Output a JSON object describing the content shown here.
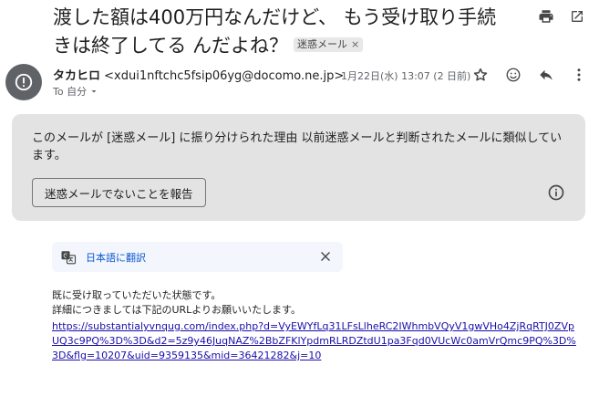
{
  "email": {
    "subject": "渡した額は400万円なんだけど、 もう受け取り手続きは終了してる んだよね？",
    "spam_label": "迷惑メール",
    "spam_label_close": "×",
    "sender_name": "タカヒロ",
    "sender_email": "<xdui1nftchc5fsip06yg@docomo.ne.jp>",
    "to_text": "To 自分",
    "date": "1月22日(水) 13:07 (2 日前)"
  },
  "warning": {
    "text": "このメールが [迷惑メール] に振り分けられた理由 以前迷惑メールと判断されたメールに類似しています。",
    "report_button": "迷惑メールでないことを報告"
  },
  "translate": {
    "label": "日本語に翻訳"
  },
  "body": {
    "line1": "既に受け取っていただいた状態です。",
    "line2": "詳細につきましては下記のURLよりお願いいたします。",
    "link": "https://substantialyvnqug.com/index.php?d=VyEWYfLq31LFsLlheRC2IWhmbVQyV1gwVHo4ZjRqRTJ0ZVpUQ3c9PQ%3D%3D&d2=5z9y46JuqNAZ%2BbZFKlYpdmRLRDZtdU1pa3Fqd0VUcWc0amVrQmc9PQ%3D%3D&flg=10207&uid=9359135&mid=36421282&j=10"
  },
  "colors": {
    "link": "#1a0dab",
    "translate_link": "#0b57d0",
    "warning_bg": "#e3e3e3",
    "avatar_bg": "#5f6368"
  }
}
